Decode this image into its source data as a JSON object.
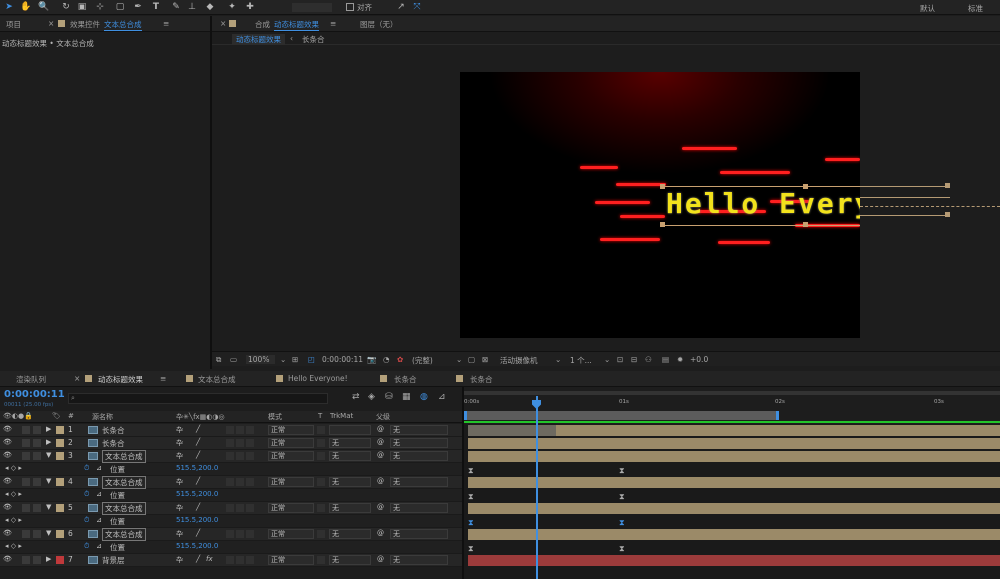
{
  "toolbar": {
    "align_label": "对齐",
    "workspace_default": "默认",
    "workspace_standard": "标准"
  },
  "project_panel": {
    "tab_project": "项目",
    "tab_effects": "效果控件",
    "tab_effects_comp": "文本总合成",
    "breadcrumb": "动态标题效果 • 文本总合成"
  },
  "comp_panel": {
    "tab_label": "合成",
    "tab_comp_name": "动态标题效果",
    "layer_tab": "图层（无）",
    "sub_tab1": "动态标题效果",
    "sub_tab2": "长条合"
  },
  "comp_view": {
    "text": "Hello Every"
  },
  "viewer_bar": {
    "zoom": "100%",
    "timecode": "0:00:00:11",
    "resolution": "(完整)",
    "camera": "活动摄像机",
    "views": "1 个...",
    "exposure": "+0.0"
  },
  "timeline_tabs": [
    "渲染队列",
    "动态标题效果",
    "文本总合成",
    "Hello Everyone!",
    "长条合",
    "长条合"
  ],
  "timeline": {
    "current_time": "0:00:00:11",
    "frame_info": "00011 (25.00 fps)",
    "col_source": "源名称",
    "col_mode": "模式",
    "col_t": "T",
    "col_trkmat": "TrkMat",
    "col_parent": "父级",
    "ruler": [
      "0:00s",
      "01s",
      "02s",
      "03s"
    ]
  },
  "layers": [
    {
      "num": "1",
      "name": "长条合",
      "mode": "正常",
      "trk": "",
      "parent": "无",
      "color": "#b3a07a"
    },
    {
      "num": "2",
      "name": "长条合",
      "mode": "正常",
      "trk": "无",
      "parent": "无",
      "color": "#b3a07a"
    },
    {
      "num": "3",
      "name": "文本总合成",
      "mode": "正常",
      "trk": "无",
      "parent": "无",
      "color": "#b3a07a",
      "prop": "位置",
      "val": "515.5,200.0"
    },
    {
      "num": "4",
      "name": "文本总合成",
      "mode": "正常",
      "trk": "无",
      "parent": "无",
      "color": "#b3a07a",
      "prop": "位置",
      "val": "515.5,200.0"
    },
    {
      "num": "5",
      "name": "文本总合成",
      "mode": "正常",
      "trk": "无",
      "parent": "无",
      "color": "#b3a07a",
      "prop": "位置",
      "val": "515.5,200.0"
    },
    {
      "num": "6",
      "name": "文本总合成",
      "mode": "正常",
      "trk": "无",
      "parent": "无",
      "color": "#b3a07a",
      "prop": "位置",
      "val": "515.5,200.0"
    },
    {
      "num": "7",
      "name": "背景层",
      "mode": "正常",
      "trk": "无",
      "parent": "无",
      "color": "#c0393b"
    }
  ]
}
